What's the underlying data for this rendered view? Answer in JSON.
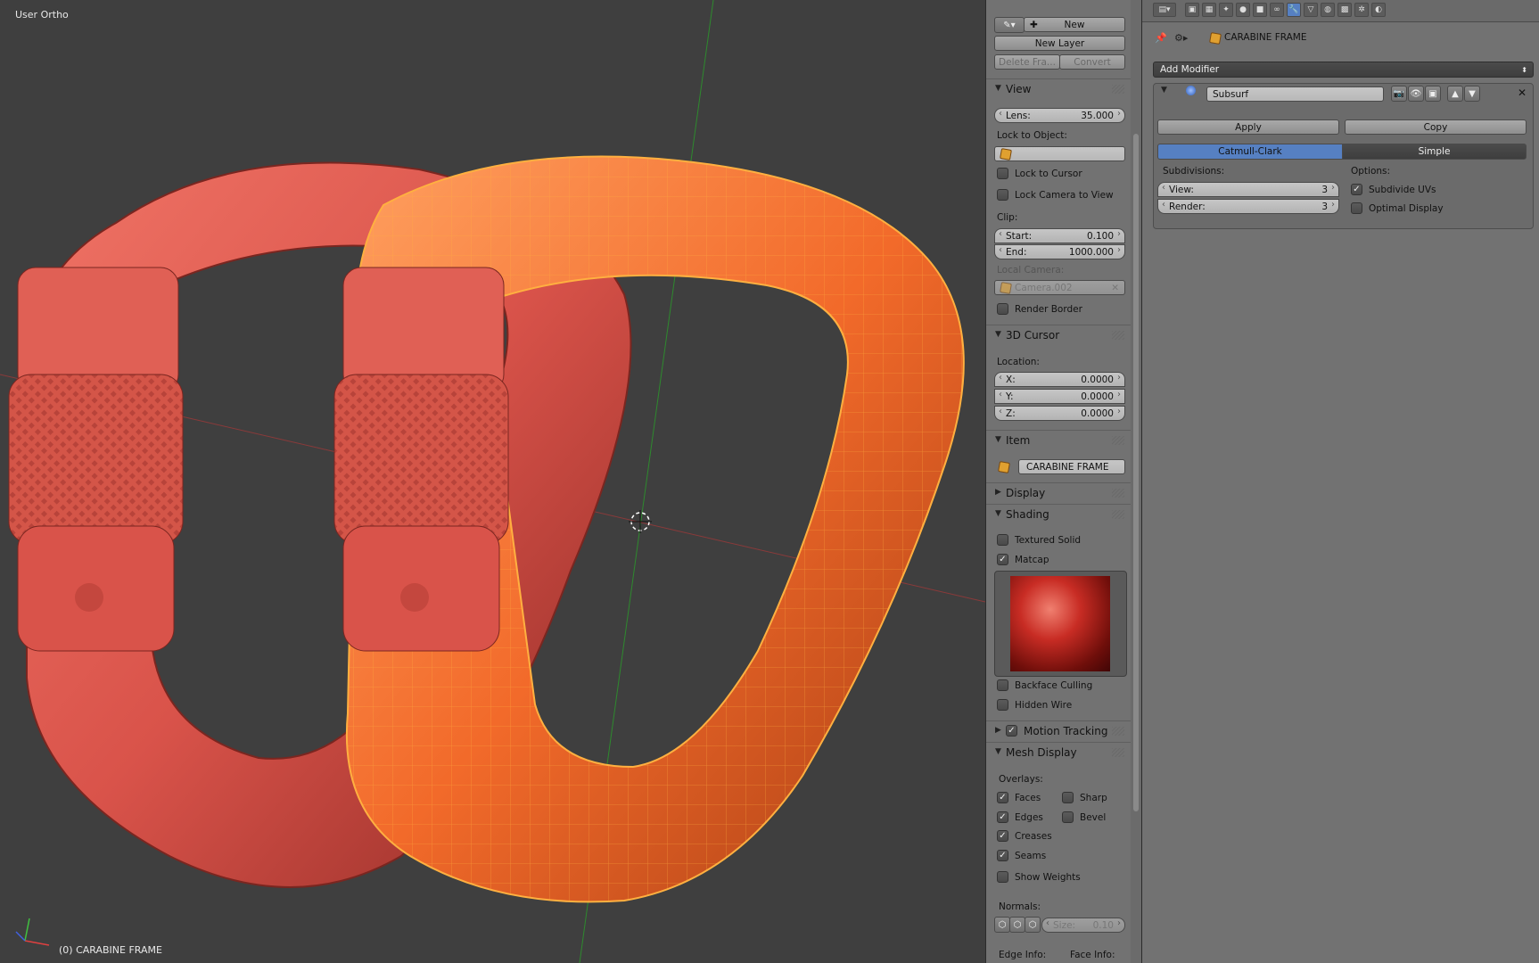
{
  "viewport": {
    "view_name": "User Ortho",
    "object_label": "(0) CARABINE FRAME"
  },
  "npanel": {
    "grease": {
      "new_label": "New",
      "new_layer_label": "New Layer",
      "delete_label": "Delete Fra...",
      "convert_label": "Convert"
    },
    "view": {
      "header": "View",
      "lens_label": "Lens:",
      "lens_value": "35.000",
      "lock_to_object_label": "Lock to Object:",
      "lock_to_cursor_label": "Lock to Cursor",
      "lock_camera_label": "Lock Camera to View",
      "clip_label": "Clip:",
      "start_label": "Start:",
      "start_value": "0.100",
      "end_label": "End:",
      "end_value": "1000.000",
      "local_camera_label": "Local Camera:",
      "local_camera_value": "Camera.002",
      "render_border_label": "Render Border"
    },
    "cursor": {
      "header": "3D Cursor",
      "location_label": "Location:",
      "x_label": "X:",
      "x_value": "0.0000",
      "y_label": "Y:",
      "y_value": "0.0000",
      "z_label": "Z:",
      "z_value": "0.0000"
    },
    "item": {
      "header": "Item",
      "name": "CARABINE FRAME"
    },
    "display": {
      "header": "Display"
    },
    "shading": {
      "header": "Shading",
      "textured_solid_label": "Textured Solid",
      "textured_solid": false,
      "matcap_label": "Matcap",
      "matcap": true,
      "backface_label": "Backface Culling",
      "backface": false,
      "hidden_wire_label": "Hidden Wire",
      "hidden_wire": false
    },
    "motion_tracking": {
      "header": "Motion Tracking",
      "enabled": true
    },
    "mesh_display": {
      "header": "Mesh Display",
      "overlays_label": "Overlays:",
      "faces_label": "Faces",
      "edges_label": "Edges",
      "creases_label": "Creases",
      "seams_label": "Seams",
      "sharp_label": "Sharp",
      "bevel_label": "Bevel",
      "show_weights_label": "Show Weights",
      "normals_label": "Normals:",
      "size_label": "Size:",
      "size_value": "0.10",
      "edge_info_label": "Edge Info:",
      "face_info_label": "Face Info:"
    }
  },
  "properties": {
    "object_name": "CARABINE FRAME",
    "add_modifier_label": "Add Modifier",
    "modifier": {
      "name": "Subsurf",
      "apply_label": "Apply",
      "copy_label": "Copy",
      "catmull_label": "Catmull-Clark",
      "simple_label": "Simple",
      "subdivisions_label": "Subdivisions:",
      "view_label": "View:",
      "view_value": "3",
      "render_label": "Render:",
      "render_value": "3",
      "options_label": "Options:",
      "subdivide_uvs_label": "Subdivide UVs",
      "subdivide_uvs": true,
      "optimal_display_label": "Optimal Display",
      "optimal_display": false
    }
  },
  "colors": {
    "accent": "#5680c2",
    "selection": "#ff8c1a",
    "object_red": "#d9534a"
  }
}
